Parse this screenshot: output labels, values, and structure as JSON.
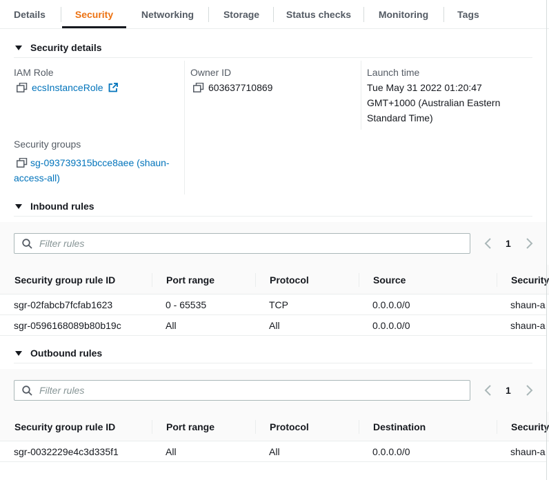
{
  "tabs": [
    {
      "label": "Details"
    },
    {
      "label": "Security"
    },
    {
      "label": "Networking"
    },
    {
      "label": "Storage"
    },
    {
      "label": "Status checks"
    },
    {
      "label": "Monitoring"
    },
    {
      "label": "Tags"
    }
  ],
  "active_tab": "Security",
  "security_details": {
    "title": "Security details",
    "iam_role_label": "IAM Role",
    "iam_role_value": "ecsInstanceRole",
    "owner_id_label": "Owner ID",
    "owner_id_value": "603637710869",
    "launch_time_label": "Launch time",
    "launch_time_lines": [
      "Tue May 31 2022 01:20:47",
      "GMT+1000 (Australian Eastern",
      "Standard Time)"
    ],
    "security_groups_label": "Security groups",
    "security_groups_lines": [
      "sg-093739315bcce8aee (shaun-",
      "access-all)"
    ]
  },
  "inbound": {
    "title": "Inbound rules",
    "filter_placeholder": "Filter rules",
    "page": "1",
    "columns": [
      "Security group rule ID",
      "Port range",
      "Protocol",
      "Source",
      "Security"
    ],
    "rows": [
      [
        "sgr-02fabcb7fcfab1623",
        "0 - 65535",
        "TCP",
        "0.0.0.0/0",
        "shaun-a"
      ],
      [
        "sgr-0596168089b80b19c",
        "All",
        "All",
        "0.0.0.0/0",
        "shaun-a"
      ]
    ]
  },
  "outbound": {
    "title": "Outbound rules",
    "filter_placeholder": "Filter rules",
    "page": "1",
    "columns": [
      "Security group rule ID",
      "Port range",
      "Protocol",
      "Destination",
      "Security"
    ],
    "rows": [
      [
        "sgr-0032229e4c3d335f1",
        "All",
        "All",
        "0.0.0.0/0",
        "shaun-a"
      ]
    ]
  },
  "colors": {
    "active_tab": "#ec7211",
    "link": "#0073bb",
    "text": "#16191f",
    "muted": "#545b64"
  },
  "icons": [
    "copy-icon",
    "external-link-icon",
    "search-icon",
    "chevron-left-icon",
    "chevron-right-icon",
    "caret-down-icon"
  ]
}
